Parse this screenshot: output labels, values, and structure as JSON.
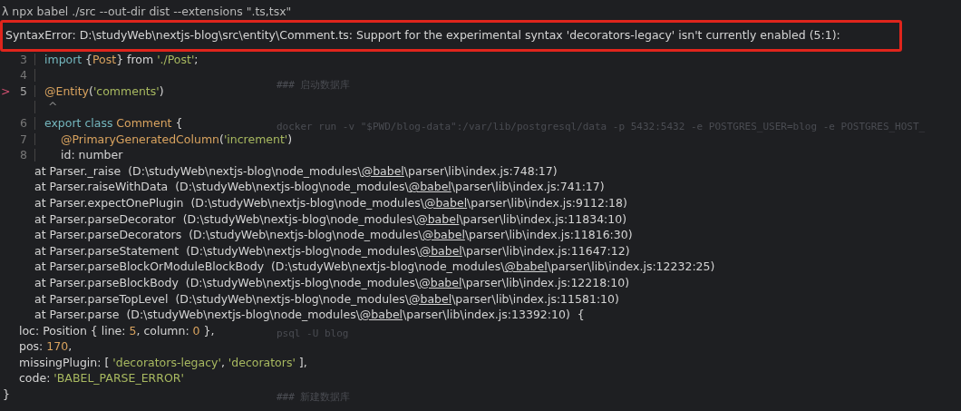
{
  "background_notes": [
    {
      "text": "### 启动数据库"
    },
    {
      "text": "docker run -v \"$PWD/blog-data\":/var/lib/postgresql/data -p 5432:5432 -e POSTGRES_USER=blog -e POSTGRES_HOST_"
    },
    {
      "text": "psql -U blog"
    },
    {
      "text": "### 新建数据库"
    }
  ],
  "terminal": {
    "lines": [
      {
        "kind": "command",
        "text": "λ npx babel ./src --out-dir dist --extensions \".ts,tsx\""
      },
      {
        "kind": "error",
        "highlighted": true,
        "text": "SyntaxError: D:\\studyWeb\\nextjs-blog\\src\\entity\\Comment.ts: Support for the experimental syntax 'decorators-legacy' isn't currently enabled (5:1):"
      },
      {
        "kind": "frame",
        "number": "3",
        "current": false,
        "tokens": [
          {
            "kind": "keyword",
            "text": "import"
          },
          {
            "kind": "plain",
            "text": "{"
          },
          {
            "kind": "name",
            "text": "Post"
          },
          {
            "kind": "plain",
            "text": "} from "
          },
          {
            "kind": "string",
            "text": "'./Post'"
          },
          {
            "kind": "plain",
            "text": ";"
          }
        ]
      },
      {
        "kind": "frame",
        "number": "4",
        "current": false
      },
      {
        "kind": "frame",
        "number": "5",
        "current": true,
        "marker": ">",
        "tokens": [
          {
            "kind": "name",
            "text": "@Entity"
          },
          {
            "kind": "plain",
            "text": "("
          },
          {
            "kind": "string",
            "text": "'comments'"
          },
          {
            "kind": "plain",
            "text": ")"
          }
        ]
      },
      {
        "kind": "caret",
        "text": "^"
      },
      {
        "kind": "frame",
        "number": "6",
        "current": false,
        "tokens": [
          {
            "kind": "keyword",
            "text": "export class"
          },
          {
            "kind": "name",
            "text": "Comment"
          },
          {
            "kind": "plain",
            "text": " {"
          }
        ]
      },
      {
        "kind": "frame",
        "number": "7",
        "current": false,
        "nested": true,
        "tokens": [
          {
            "kind": "name",
            "text": "@PrimaryGeneratedColumn"
          },
          {
            "kind": "plain",
            "text": "("
          },
          {
            "kind": "string",
            "text": "'increment'"
          },
          {
            "kind": "plain",
            "text": ")"
          }
        ]
      },
      {
        "kind": "frame",
        "number": "8",
        "current": false,
        "nested": true,
        "tokens": [
          {
            "kind": "plain",
            "text": "id: number"
          }
        ]
      },
      {
        "kind": "stack",
        "prefix": "at",
        "func": "Parser._raise",
        "before": "(D:\\studyWeb\\nextjs-blog\\node_modules\\",
        "link": "@babel",
        "after": "\\parser\\lib\\index.js:748:17)"
      },
      {
        "kind": "stack",
        "prefix": "at",
        "func": "Parser.raiseWithData",
        "before": "(D:\\studyWeb\\nextjs-blog\\node_modules\\",
        "link": "@babel",
        "after": "\\parser\\lib\\index.js:741:17)"
      },
      {
        "kind": "stack",
        "prefix": "at",
        "func": "Parser.expectOnePlugin",
        "before": "(D:\\studyWeb\\nextjs-blog\\node_modules\\",
        "link": "@babel",
        "after": "\\parser\\lib\\index.js:9112:18)"
      },
      {
        "kind": "stack",
        "prefix": "at",
        "func": "Parser.parseDecorator",
        "before": "(D:\\studyWeb\\nextjs-blog\\node_modules\\",
        "link": "@babel",
        "after": "\\parser\\lib\\index.js:11834:10)"
      },
      {
        "kind": "stack",
        "prefix": "at",
        "func": "Parser.parseDecorators",
        "before": "(D:\\studyWeb\\nextjs-blog\\node_modules\\",
        "link": "@babel",
        "after": "\\parser\\lib\\index.js:11816:30)"
      },
      {
        "kind": "stack",
        "prefix": "at",
        "func": "Parser.parseStatement",
        "before": "(D:\\studyWeb\\nextjs-blog\\node_modules\\",
        "link": "@babel",
        "after": "\\parser\\lib\\index.js:11647:12)"
      },
      {
        "kind": "stack",
        "prefix": "at",
        "func": "Parser.parseBlockOrModuleBlockBody",
        "before": "(D:\\studyWeb\\nextjs-blog\\node_modules\\",
        "link": "@babel",
        "after": "\\parser\\lib\\index.js:12232:25)"
      },
      {
        "kind": "stack",
        "prefix": "at",
        "func": "Parser.parseBlockBody",
        "before": "(D:\\studyWeb\\nextjs-blog\\node_modules\\",
        "link": "@babel",
        "after": "\\parser\\lib\\index.js:12218:10)"
      },
      {
        "kind": "stack",
        "prefix": "at",
        "func": "Parser.parseTopLevel",
        "before": "(D:\\studyWeb\\nextjs-blog\\node_modules\\",
        "link": "@babel",
        "after": "\\parser\\lib\\index.js:11581:10)"
      },
      {
        "kind": "stack",
        "prefix": "at",
        "func": "Parser.parse",
        "before": "(D:\\studyWeb\\nextjs-blog\\node_modules\\",
        "link": "@babel",
        "after": "\\parser\\lib\\index.js:13392:10)  {"
      },
      {
        "kind": "property",
        "tokens": [
          {
            "kind": "plain",
            "text": "loc: Position { line: "
          },
          {
            "kind": "number",
            "text": "5"
          },
          {
            "kind": "plain",
            "text": ", column: "
          },
          {
            "kind": "number",
            "text": "0"
          },
          {
            "kind": "plain",
            "text": " },"
          }
        ]
      },
      {
        "kind": "property",
        "tokens": [
          {
            "kind": "plain",
            "text": "pos: "
          },
          {
            "kind": "number",
            "text": "170"
          },
          {
            "kind": "plain",
            "text": ","
          }
        ]
      },
      {
        "kind": "property",
        "tokens": [
          {
            "kind": "plain",
            "text": "missingPlugin: [ "
          },
          {
            "kind": "string",
            "text": "'decorators-legacy'"
          },
          {
            "kind": "plain",
            "text": ", "
          },
          {
            "kind": "string",
            "text": "'decorators'"
          },
          {
            "kind": "plain",
            "text": " ],"
          }
        ]
      },
      {
        "kind": "property",
        "tokens": [
          {
            "kind": "plain",
            "text": "code: "
          },
          {
            "kind": "string",
            "text": "'BABEL_PARSE_ERROR'"
          }
        ]
      },
      {
        "kind": "close",
        "text": "}"
      }
    ]
  }
}
